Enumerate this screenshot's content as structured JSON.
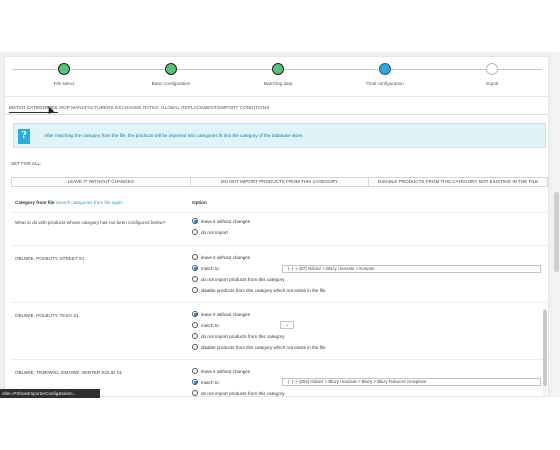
{
  "stepper": {
    "steps": [
      {
        "label": "File select",
        "state": "done"
      },
      {
        "label": "Basic configuration",
        "state": "done"
      },
      {
        "label": "Matching data",
        "state": "done"
      },
      {
        "label": "Final configuration",
        "state": "active"
      },
      {
        "label": "Import",
        "state": "todo"
      }
    ]
  },
  "tabs": [
    "MATCH CATEGORIES",
    "SKIP MANUFACTURERS",
    "EXCHANGE RATES",
    "GLOBAL REPLACEMENTS",
    "IMPORT CONDITIONS"
  ],
  "info": {
    "icon": "info-icon",
    "text": "After matching the category from the file, the products will be imported into categories fit into the category of the database store."
  },
  "set_for_all": {
    "label": "SET FOR ALL:",
    "buttons": [
      "LEAVE IT WITHOUT CHANGES",
      "DO NOT IMPORT PRODUCTS FROM THIS CATEGORY",
      "DISABLE PRODUCTS FROM THIS CATEGORY NOT EXISTING IN THE FILE"
    ]
  },
  "table_header": {
    "category_label": "Category from file",
    "search_link": "Search categories from file again",
    "option_label": "Option"
  },
  "default_row": {
    "question": "What to do with products whose category has not been configured below?",
    "options": [
      "leave it without changes",
      "do not import"
    ],
    "selected": 0
  },
  "rows": [
    {
      "category": "OBUWIE, POLBUTY, STREET S1",
      "options": [
        "leave it without changes",
        "match to:",
        "do not import products from this category",
        "disable products from this category which not exists in the file"
      ],
      "selected": 1,
      "match_value": "|- |- |--[57] Odzież > Bluzy i koszule > Koszule"
    },
    {
      "category": "OBUWIE, POLBUTY, TEXO S1",
      "options": [
        "leave it without changes",
        "match to:",
        "do not import products from this category",
        "disable products from this category which not exists in the file"
      ],
      "selected": 0,
      "match_value": "⌄"
    },
    {
      "category": "OBUWIE, TRZEWIKI, ZIMOWE, WINTER SOLID S1",
      "options": [
        "leave it without changes",
        "match to:",
        "do not import products from this category"
      ],
      "selected": 1,
      "match_value": "|- |- |--[204] Odzież > Bluzy i koszule > Bluzy > Bluzy Robocze Ocieplane"
    }
  ],
  "status_tooltip": "oller=PShowImporterConfig&token..."
}
